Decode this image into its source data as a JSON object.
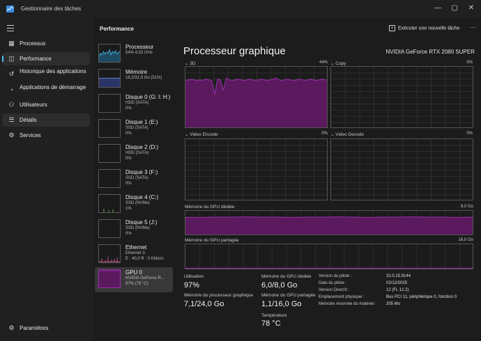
{
  "window": {
    "title": "Gestionnaire des tâches",
    "controls": [
      "—",
      "▢",
      "✕"
    ]
  },
  "nav": {
    "items": [
      {
        "label": "Processus",
        "icon": "processes-icon"
      },
      {
        "label": "Performance",
        "icon": "performance-icon",
        "active": true
      },
      {
        "label": "Historique des applications",
        "icon": "history-icon"
      },
      {
        "label": "Applications de démarrage",
        "icon": "startup-icon"
      },
      {
        "label": "Utilisateurs",
        "icon": "users-icon"
      },
      {
        "label": "Détails",
        "icon": "details-icon",
        "selected": true
      },
      {
        "label": "Services",
        "icon": "services-icon"
      }
    ],
    "settings": "Paramètres"
  },
  "header": {
    "title": "Performance",
    "run_task": "Exécuter une nouvelle tâche",
    "more": "⋯"
  },
  "devices": [
    {
      "name": "Processeur",
      "sub1": "54% 4,53 GHz",
      "sub2": "",
      "type": "cpu"
    },
    {
      "name": "Mémoire",
      "sub1": "16,2/31,9 Go (51%)",
      "sub2": "",
      "type": "mem"
    },
    {
      "name": "Disque 0 (G: I: H:)",
      "sub1": "HDD (SATA)",
      "sub2": "0%",
      "type": "disk"
    },
    {
      "name": "Disque 1 (E:)",
      "sub1": "SSD (SATA)",
      "sub2": "0%",
      "type": "disk"
    },
    {
      "name": "Disque 2 (D:)",
      "sub1": "HDD (SATA)",
      "sub2": "0%",
      "type": "disk"
    },
    {
      "name": "Disque 3 (F:)",
      "sub1": "SSD (SATA)",
      "sub2": "0%",
      "type": "disk"
    },
    {
      "name": "Disque 4 (C:)",
      "sub1": "SSD (NVMe)",
      "sub2": "1%",
      "type": "disk4"
    },
    {
      "name": "Disque 5 (J:)",
      "sub1": "SSD (NVMe)",
      "sub2": "0%",
      "type": "disk"
    },
    {
      "name": "Ethernet",
      "sub1": "Ethernet 3",
      "sub2": "E : 40,0 R : 0 Kbits/s",
      "type": "eth"
    },
    {
      "name": "GPU 0",
      "sub1": "NVIDIA GeForce R...",
      "sub2": "97% (78 °C)",
      "type": "gpu",
      "active": true
    }
  ],
  "gpu": {
    "title": "Processeur graphique",
    "model": "NVIDIA GeForce RTX 2080 SUPER",
    "engines": [
      {
        "label": "3D",
        "pct": "44%"
      },
      {
        "label": "Copy",
        "pct": "0%"
      },
      {
        "label": "Video Encode",
        "pct": "0%"
      },
      {
        "label": "Video Decode",
        "pct": "0%"
      }
    ],
    "dedicated_label": "Mémoire du GPU dédiée",
    "dedicated_max": "8,0 Go",
    "shared_label": "Mémoire du GPU partagée",
    "shared_max": "16,0 Go"
  },
  "stats": {
    "utilisation_label": "Utilisation",
    "utilisation": "97%",
    "dedicated_label": "Mémoire du GPU dédiée",
    "dedicated": "6,0/8,0 Go",
    "shared_label": "Mémoire du GPU partagée",
    "shared": "1,1/16,0 Go",
    "gpu_mem_label": "Mémoire du processeur graphique",
    "gpu_mem": "7,1/24,0 Go",
    "temp_label": "Température",
    "temp": "78 °C"
  },
  "info": [
    {
      "k": "Version du pilote :",
      "v": "32.0.15.9144"
    },
    {
      "k": "Date du pilote :",
      "v": "02/12/2025"
    },
    {
      "k": "Version DirectX :",
      "v": "12 (FL 12.2)"
    },
    {
      "k": "Emplacement physique :",
      "v": "Bus PCI 11, périphérique 0, fonction 0"
    },
    {
      "k": "Mémoire réservée du matériel :",
      "v": "205 Mo"
    }
  ],
  "series": {
    "gpu_3d": [
      0.78,
      0.79,
      0.8,
      0.79,
      0.78,
      0.79,
      0.78,
      0.8,
      0.79,
      0.78,
      0.55,
      0.8,
      0.79,
      0.62,
      0.82,
      0.79,
      0.78,
      0.79,
      0.8,
      0.79,
      0.78,
      0.79,
      0.8,
      0.79,
      0.78,
      0.79,
      0.8,
      0.79,
      0.78,
      0.79,
      0.8,
      0.82,
      0.79,
      0.78,
      0.79,
      0.8,
      0.79,
      0.78,
      0.79,
      0.8,
      0.79,
      0.78,
      0.79,
      0.8,
      0.79,
      0.78,
      0.79,
      0.8,
      0.79,
      0.78
    ],
    "dedicated": [
      0.74,
      0.74,
      0.75,
      0.75,
      0.76,
      0.75,
      0.75,
      0.74,
      0.75,
      0.75,
      0.76,
      0.75,
      0.74,
      0.75,
      0.75,
      0.76,
      0.75,
      0.75,
      0.74,
      0.75
    ],
    "shared": [
      0.07,
      0.07,
      0.07,
      0.07,
      0.07,
      0.07,
      0.07,
      0.07,
      0.07,
      0.07
    ]
  },
  "colors": {
    "accent": "#4cc2ff",
    "gpu_line": "#9b2fae",
    "gpu_fill": "#5b1a5e",
    "cpu_line": "#3fa7d6",
    "mem_line": "#6a7ecf",
    "eth_line": "#c0508a",
    "disk_line": "#6ab04c"
  }
}
